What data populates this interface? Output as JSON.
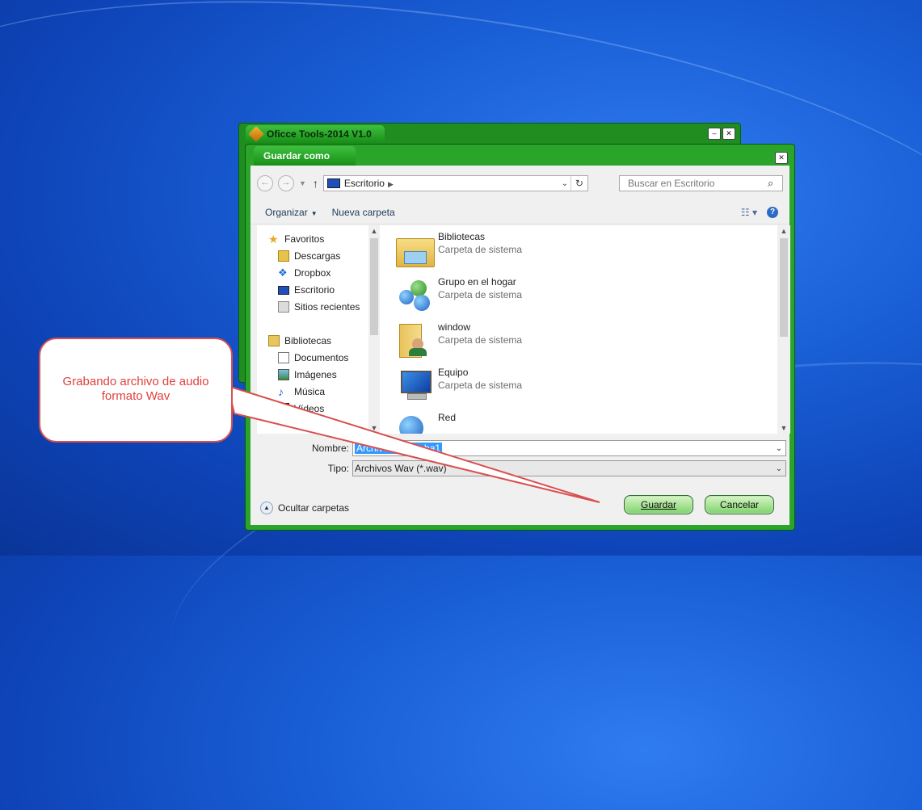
{
  "back_window": {
    "title": "Oficce Tools-2014  V1.0"
  },
  "dialog": {
    "title": "Guardar como",
    "address": {
      "crumb": "Escritorio"
    },
    "search": {
      "placeholder": "Buscar en Escritorio"
    },
    "toolbar": {
      "organize": "Organizar",
      "new_folder": "Nueva carpeta"
    },
    "sidebar": {
      "favorites": {
        "label": "Favoritos",
        "items": [
          "Descargas",
          "Dropbox",
          "Escritorio",
          "Sitios recientes"
        ]
      },
      "libraries": {
        "label": "Bibliotecas",
        "items": [
          "Documentos",
          "Imágenes",
          "Música",
          "Vídeos"
        ]
      }
    },
    "files": [
      {
        "name": "Bibliotecas",
        "desc": "Carpeta de sistema"
      },
      {
        "name": "Grupo en el hogar",
        "desc": "Carpeta de sistema"
      },
      {
        "name": "window",
        "desc": "Carpeta de sistema"
      },
      {
        "name": "Equipo",
        "desc": "Carpeta de sistema"
      },
      {
        "name": "Red",
        "desc": ""
      }
    ],
    "form": {
      "name_label": "Nombre:",
      "name_value": "Archivo de prueba1",
      "type_label": "Tipo:",
      "type_value": "Archivos Wav (*.wav)"
    },
    "hide_folders": "Ocultar carpetas",
    "save_button": "Guardar",
    "cancel_button": "Cancelar"
  },
  "callout": {
    "line1": "Grabando archivo de audio",
    "line2": "formato Wav"
  }
}
